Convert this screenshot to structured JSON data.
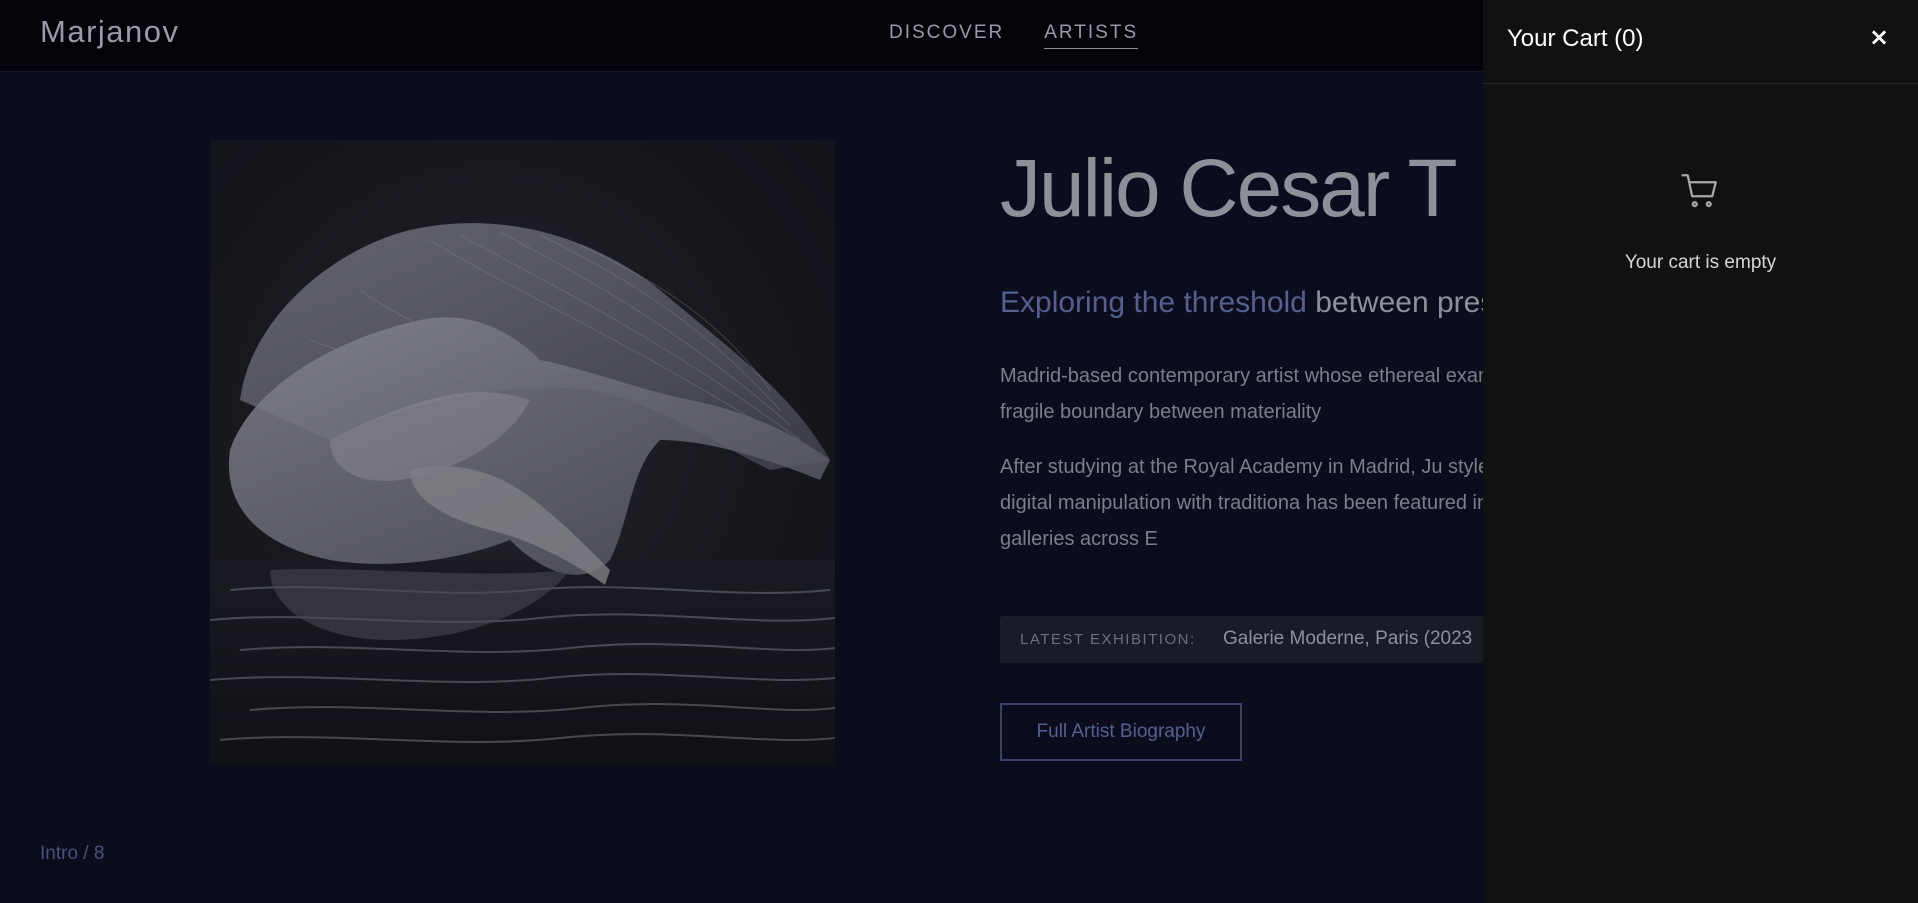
{
  "header": {
    "logo": "Marjanov",
    "nav": [
      {
        "label": "DISCOVER",
        "active": false
      },
      {
        "label": "ARTISTS",
        "active": true
      }
    ]
  },
  "artist": {
    "name": "Julio Cesar T",
    "tagline_accent": "Exploring the threshold",
    "tagline_rest": "between pres",
    "bio_paragraphs": [
      "Madrid-based contemporary artist whose ethereal examine the fragile boundary between materiality",
      "After studying at the Royal Academy in Madrid, Ju style combining digital manipulation with traditiona has been featured in prestigious galleries across E"
    ],
    "exhibition_label": "LATEST EXHIBITION:",
    "exhibition_value": "Galerie Moderne, Paris (2023",
    "biography_button": "Full Artist Biography"
  },
  "slide_counter": "Intro / 8",
  "cart": {
    "title": "Your Cart (0)",
    "close_icon": "×",
    "empty_message": "Your cart is empty",
    "icon": "shopping-cart-icon"
  },
  "colors": {
    "page_background": "#0b0c1e",
    "header_background": "#030309",
    "accent": "#55608e",
    "cart_background": "#111111"
  }
}
